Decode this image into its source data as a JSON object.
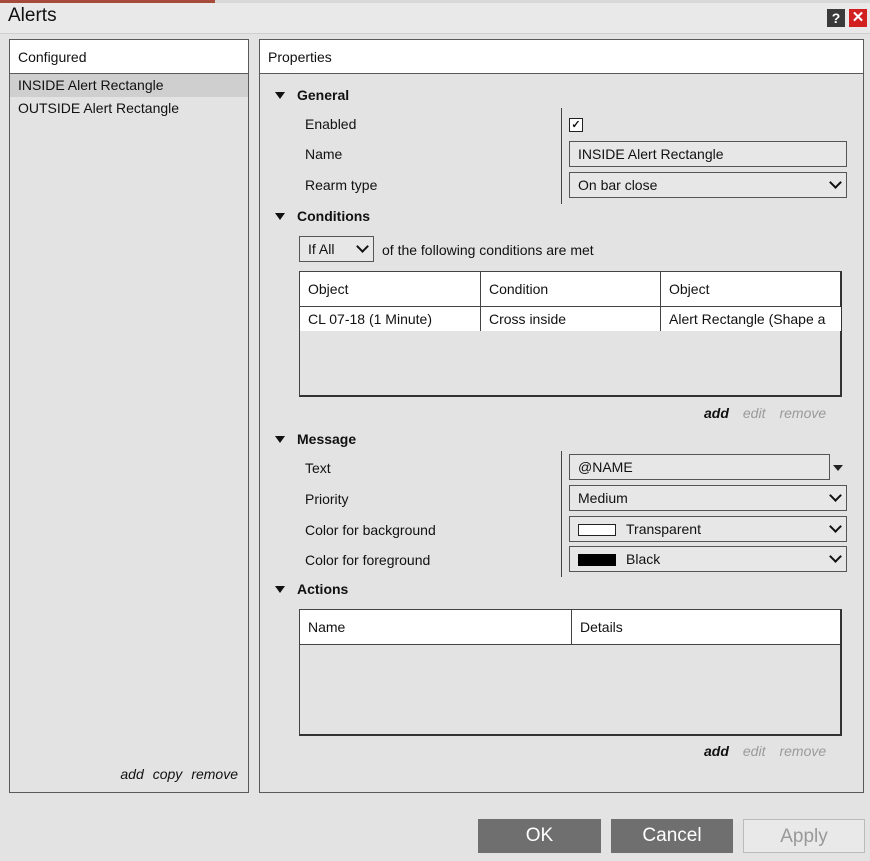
{
  "window": {
    "title": "Alerts",
    "help_label": "?",
    "close_label": "✕"
  },
  "configured": {
    "header": "Configured",
    "items": [
      "INSIDE Alert Rectangle",
      "OUTSIDE Alert Rectangle"
    ],
    "selected_index": 0,
    "links": {
      "add": "add",
      "copy": "copy",
      "remove": "remove"
    }
  },
  "properties": {
    "header": "Properties",
    "general": {
      "title": "General",
      "enabled_label": "Enabled",
      "enabled_value": "✓",
      "name_label": "Name",
      "name_value": "INSIDE Alert Rectangle",
      "rearm_label": "Rearm type",
      "rearm_value": "On bar close"
    },
    "conditions": {
      "title": "Conditions",
      "match_value": "If All",
      "match_text": "of the following conditions are met",
      "columns": [
        "Object",
        "Condition",
        "Object"
      ],
      "rows": [
        [
          "CL 07-18 (1 Minute)",
          "Cross inside",
          "Alert Rectangle (Shape a"
        ]
      ],
      "links": {
        "add": "add",
        "edit": "edit",
        "remove": "remove"
      }
    },
    "message": {
      "title": "Message",
      "text_label": "Text",
      "text_value": "@NAME",
      "priority_label": "Priority",
      "priority_value": "Medium",
      "bg_label": "Color for background",
      "bg_value": "Transparent",
      "bg_color": "#ffffff",
      "fg_label": "Color for foreground",
      "fg_value": "Black",
      "fg_color": "#000000"
    },
    "actions": {
      "title": "Actions",
      "columns": [
        "Name",
        "Details"
      ],
      "links": {
        "add": "add",
        "edit": "edit",
        "remove": "remove"
      }
    }
  },
  "buttons": {
    "ok": "OK",
    "cancel": "Cancel",
    "apply": "Apply"
  }
}
